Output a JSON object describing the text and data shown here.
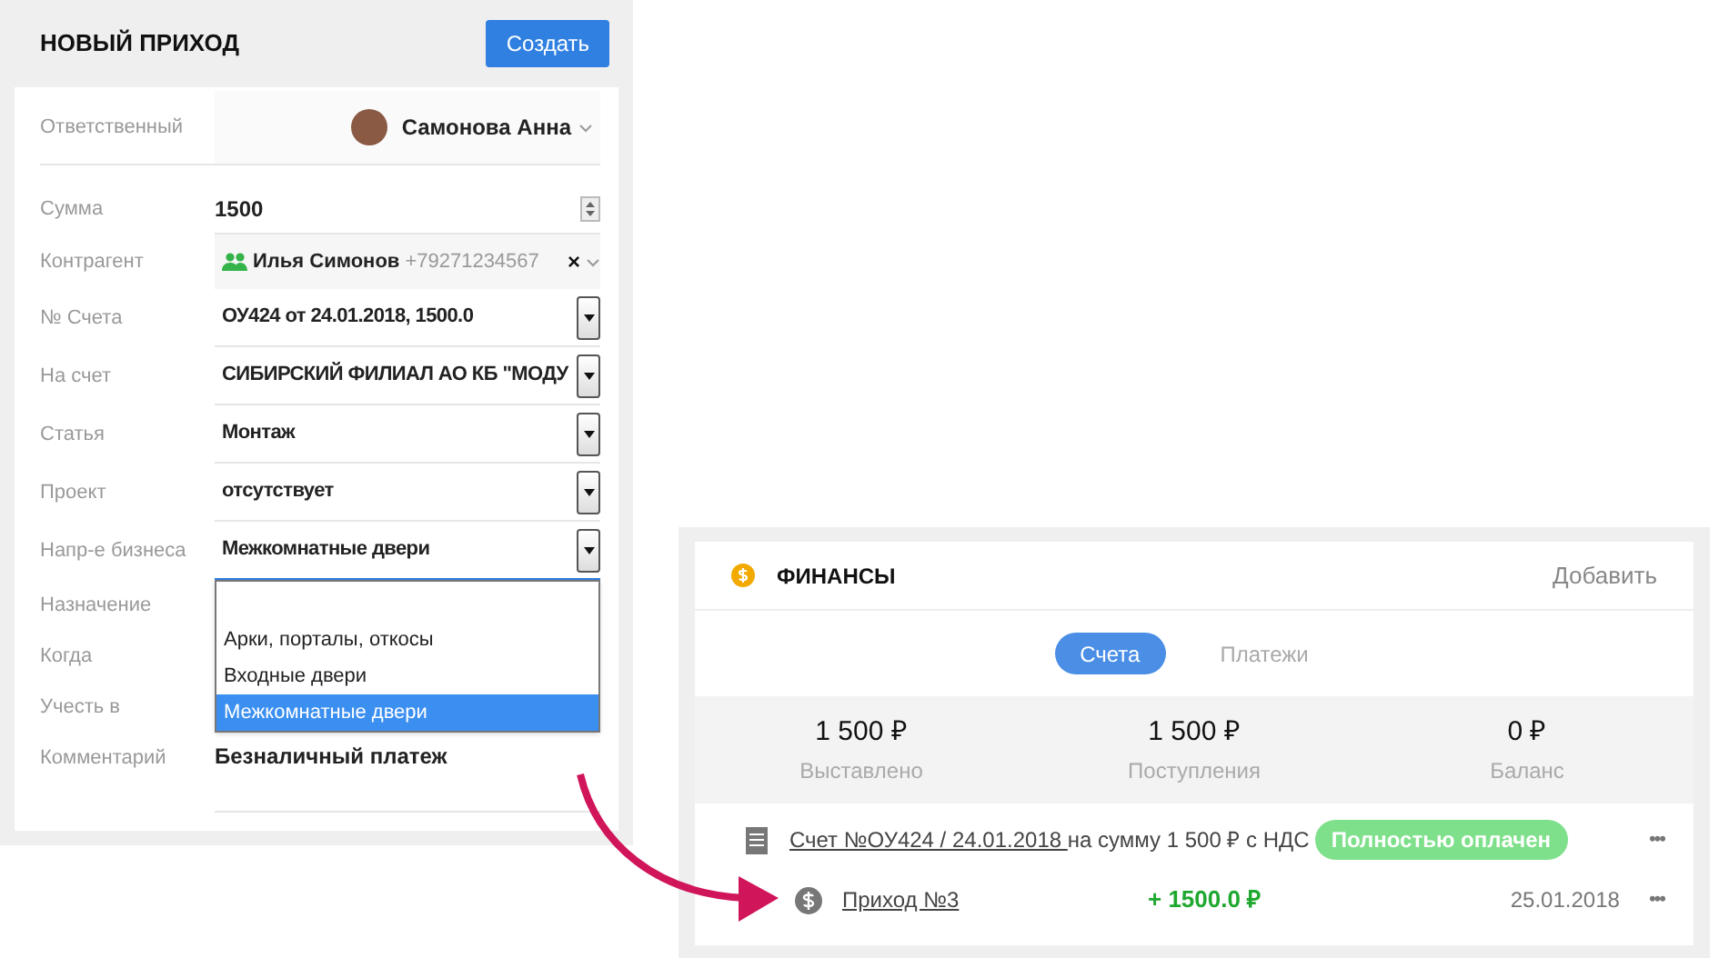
{
  "form": {
    "title": "НОВЫЙ ПРИХОД",
    "create_button": "Создать",
    "fields": [
      {
        "label": "Ответственный",
        "kind": "person",
        "value": "Самонова Анна"
      },
      {
        "label": "Сумма",
        "kind": "number",
        "value": "1500"
      },
      {
        "label": "Контрагент",
        "kind": "contact",
        "value": "Илья Симонов",
        "phone": "+79271234567",
        "clear": "×"
      },
      {
        "label": "№ Счета",
        "kind": "select",
        "value": "ОУ424 от 24.01.2018, 1500.0",
        "expanded": false
      },
      {
        "label": "На счет",
        "kind": "select",
        "value": "СИБИРСКИЙ ФИЛИАЛ АО КБ \"МОДУ",
        "expanded": false
      },
      {
        "label": "Статья",
        "kind": "select",
        "value": "Монтаж",
        "expanded": false
      },
      {
        "label": "Проект",
        "kind": "select",
        "value": "отсутствует",
        "expanded": false
      },
      {
        "label": "Напр-е бизнеса",
        "kind": "select",
        "value": "Межкомнатные двери",
        "expanded": true,
        "options": [
          {
            "label": "Арки, порталы, откосы",
            "selected": false
          },
          {
            "label": "Входные двери",
            "selected": false
          },
          {
            "label": "Межкомнатные двери",
            "selected": true
          }
        ]
      },
      {
        "label": "Назначение",
        "kind": "text"
      },
      {
        "label": "Когда",
        "kind": "text"
      },
      {
        "label": "Учесть в",
        "kind": "text"
      },
      {
        "label": "Комментарий",
        "kind": "textarea",
        "value": "Безналичный платеж"
      }
    ]
  },
  "finance": {
    "title": "ФИНАНСЫ",
    "add_link": "Добавить",
    "tabs": [
      {
        "label": "Счета",
        "selected": true
      },
      {
        "label": "Платежи",
        "selected": false
      }
    ],
    "stats": [
      {
        "value": "1 500 ₽",
        "label": "Выставлено"
      },
      {
        "value": "1 500 ₽",
        "label": "Поступления"
      },
      {
        "value": "0 ₽",
        "label": "Баланс"
      }
    ],
    "invoice": {
      "link": "Счет №ОУ424 / 24.01.2018 ",
      "text": "на сумму 1 500 ₽ с НДС",
      "status": "Полностью оплачен",
      "menu": "•••"
    },
    "payment": {
      "link": "Приход №3",
      "amount": "+ 1500.0 ₽",
      "date": "25.01.2018",
      "menu": "•••"
    }
  }
}
